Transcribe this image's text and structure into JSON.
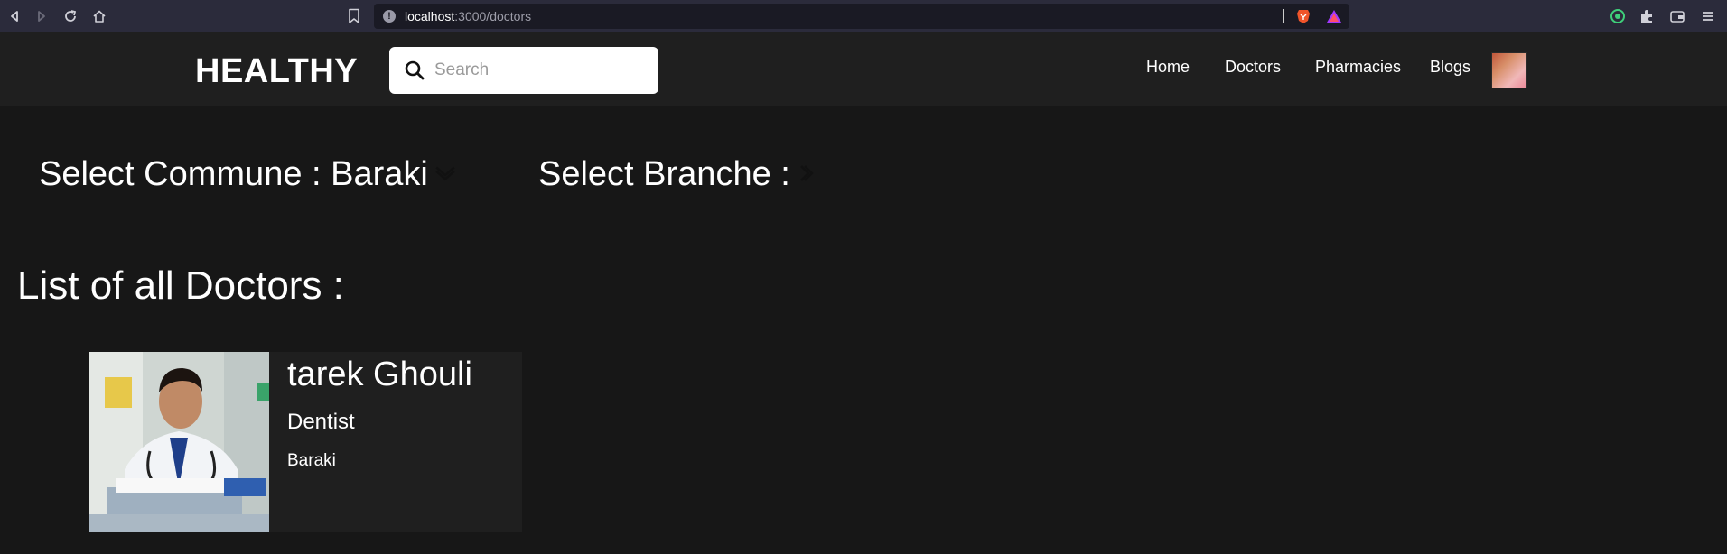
{
  "browser": {
    "url_host": "localhost",
    "url_path": ":3000/doctors"
  },
  "header": {
    "brand": "HEALTHY",
    "search_placeholder": "Search",
    "search_value": "",
    "nav": [
      {
        "label": "Home"
      },
      {
        "label": "Doctors"
      },
      {
        "label": "Pharmacies"
      },
      {
        "label": "Blogs"
      }
    ],
    "avatar_icon": "user-avatar"
  },
  "filters": {
    "commune_label": "Select Commune : Baraki",
    "branche_label": "Select Branche :"
  },
  "list": {
    "title": "List of all Doctors :",
    "doctors": [
      {
        "name": "tarek Ghouli",
        "specialty": "Dentist",
        "commune": "Baraki"
      }
    ]
  },
  "colors": {
    "page_bg": "#171717",
    "header_bg": "#1f1f1f",
    "card_bg": "#1f1f1f",
    "chrome_bg": "#2b2b3b",
    "text": "#ffffff"
  }
}
